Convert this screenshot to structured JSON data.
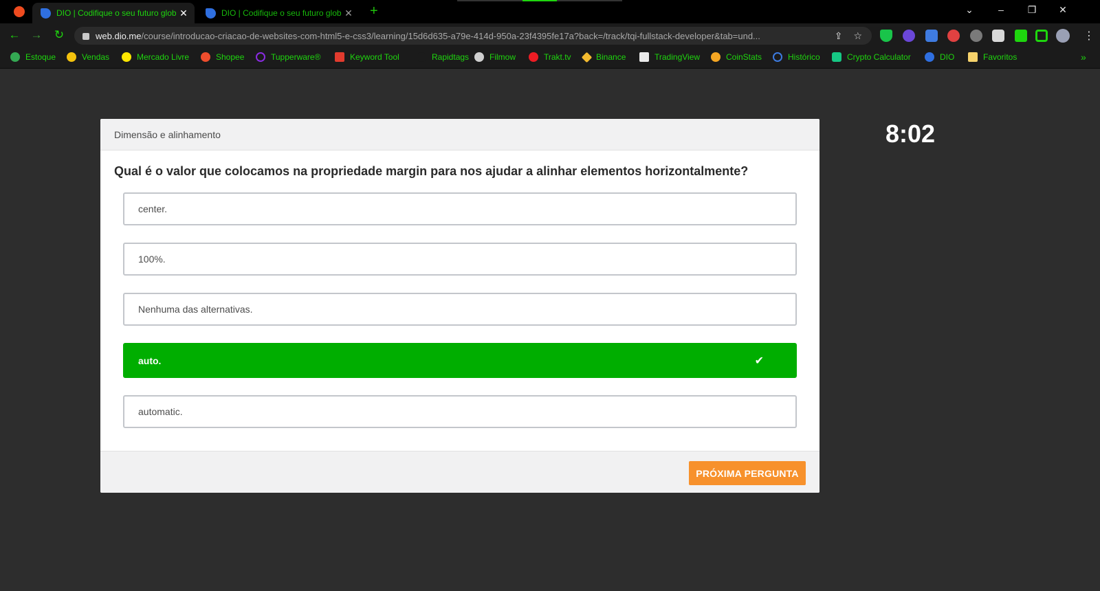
{
  "browser": {
    "tabs": [
      {
        "title": "DIO | Codifique o seu futuro glob",
        "active": true,
        "close": "✕"
      },
      {
        "title": "DIO | Codifique o seu futuro glob",
        "active": false,
        "close": "✕"
      }
    ],
    "new_tab": "+",
    "window_controls": {
      "dropdown": "⌄",
      "minimize": "–",
      "restore": "❐",
      "close": "✕"
    },
    "nav": {
      "back": "←",
      "forward": "→",
      "reload": "↻"
    },
    "url_host": "web.dio.me",
    "url_path": "/course/introducao-criacao-de-websites-com-html5-e-css3/learning/15d6d635-a79e-414d-950a-23f4395fe17a?back=/track/tqi-fullstack-developer&tab=und...",
    "omnibox_icons": {
      "share": "⇪",
      "star": "☆"
    },
    "menu": "⋮",
    "accent_color": "#1ed60e",
    "extensions": [
      {
        "name": "shield-extension-icon",
        "color": "#19c44a"
      },
      {
        "name": "download-extension-icon",
        "color": "#6a47d8"
      },
      {
        "name": "tag-extension-icon",
        "color": "#3f7be0"
      },
      {
        "name": "timer-extension-icon",
        "color": "#e04141"
      },
      {
        "name": "cookie-extension-icon",
        "color": "#7a7a7a"
      },
      {
        "name": "reader-extension-icon",
        "color": "#d8d8d8"
      },
      {
        "name": "puzzle-extension-icon",
        "color": "#1ed60e"
      },
      {
        "name": "sidebar-extension-icon",
        "color": "#1ed60e"
      },
      {
        "name": "profile-avatar-icon",
        "color": "#9aa0b5"
      }
    ]
  },
  "bookmarks": [
    {
      "label": "Estoque",
      "icon_color": "#34a853"
    },
    {
      "label": "Vendas",
      "icon_color": "#f4c20d"
    },
    {
      "label": "Mercado Livre",
      "icon_color": "#ffe600"
    },
    {
      "label": "Shopee",
      "icon_color": "#ee4d2d"
    },
    {
      "label": "Tupperware®",
      "icon_color": "#8a2be2"
    },
    {
      "label": "Keyword Tool",
      "icon_color": "#e23b2e"
    },
    {
      "label": "Rapidtags",
      "icon_color": "#1b1b1b"
    },
    {
      "label": "Filmow",
      "icon_color": "#cfcfcf"
    },
    {
      "label": "Trakt.tv",
      "icon_color": "#ed1c24"
    },
    {
      "label": "Binance",
      "icon_color": "#f3ba2f"
    },
    {
      "label": "TradingView",
      "icon_color": "#eaeaea"
    },
    {
      "label": "CoinStats",
      "icon_color": "#f5a623"
    },
    {
      "label": "Histórico",
      "icon_color": "#3d7be0"
    },
    {
      "label": "Crypto Calculator",
      "icon_color": "#16c784"
    },
    {
      "label": "DIO",
      "icon_color": "#2f6fe0"
    },
    {
      "label": "Favoritos",
      "icon_color": "#f6d26b"
    }
  ],
  "bookmarks_more": "»",
  "quiz": {
    "section": "Dimensão e alinhamento",
    "question": "Qual é o valor que colocamos na propriedade margin para nos ajudar a alinhar elementos horizontalmente?",
    "options": [
      {
        "text": "center.",
        "correct": false
      },
      {
        "text": "100%.",
        "correct": false
      },
      {
        "text": "Nenhuma das alternativas.",
        "correct": false
      },
      {
        "text": "auto.",
        "correct": true
      },
      {
        "text": "automatic.",
        "correct": false
      }
    ],
    "check_mark": "✔",
    "next_button": "PRÓXIMA PERGUNTA",
    "correct_color": "#00ae00",
    "button_color": "#f7912c"
  },
  "timer": "8:02"
}
